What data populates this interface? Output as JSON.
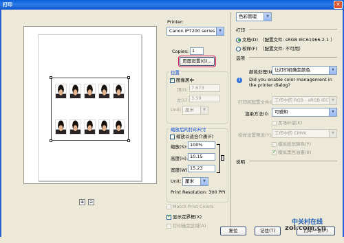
{
  "window": {
    "title": "打印",
    "close_glyph": "✕"
  },
  "preview": {
    "tool_left": "⊕",
    "tool_right": "⊖"
  },
  "printer": {
    "label": "Printer:",
    "selected": "Canon iP7200 series"
  },
  "copies": {
    "label": "Copies:",
    "value": "1"
  },
  "page_setup_button": "页面设置(G)...",
  "position": {
    "title": "位置",
    "center_label": "图像居中",
    "top_label": "顶(I):",
    "top_value": "7.673",
    "left_label": "左(L):",
    "left_value": "3.59",
    "unit_label": "Unit:",
    "unit_value": "厘米"
  },
  "scaled_print_size": {
    "title": "缩放后的打印尺寸",
    "fit_media_label": "缩放以适合介质(F)",
    "scale_label": "缩放(S):",
    "scale_value": "100%",
    "height_label": "高度(H):",
    "height_value": "10.15",
    "width_label": "宽度(W):",
    "width_value": "15.23",
    "unit_label": "Unit:",
    "unit_value": "厘米",
    "resolution": "Print Resolution: 300 PPI"
  },
  "bottom_options": {
    "match_colors": "Match Print Colors",
    "bounding_box": "显示定界框(X)",
    "print_selected_area": "打印选定区域(A)"
  },
  "color_management": {
    "dropdown": "色彩管理",
    "print_title": "打印",
    "document_radio": "文档(D)",
    "document_profile": "（配置文件: sRGB IEC61966-2.1 ）",
    "proof_radio": "校样(F)",
    "proof_profile": "（配置文件: 不可用）",
    "options_title": "选项",
    "color_handling_label": "颜色处理(N):",
    "color_handling_value": "让打印机确定颜色",
    "info_icon_glyph": "i",
    "info_text": "Did you enable color management in the printer dialog?",
    "printer_profile_label": "打印机配置文件(R):",
    "printer_profile_value": "工作中的 RGB - sRGB IEC6...",
    "rendering_intent_label": "渲染方法(I):",
    "rendering_intent_value": "可感知",
    "black_point_label": "黑场补偿(K)",
    "proof_setup_label": "校样设置预设(Y):",
    "proof_setup_value": "工作中的 CMYK",
    "simulate_paper_label": "模拟纸张颜色(P)",
    "simulate_black_label": "模拟黑色油墨(B)",
    "description_title": "说明"
  },
  "buttons": {
    "reset": "复位",
    "remember": "记住(T)",
    "print_one": "打印一份(P)"
  },
  "watermark": {
    "name": "中关村在线",
    "domain": "zol.com.cn"
  },
  "colors": {
    "accent_blue": "#0046d5",
    "highlight_red": "#d4145a",
    "titlebar": "#0a5fd8"
  }
}
